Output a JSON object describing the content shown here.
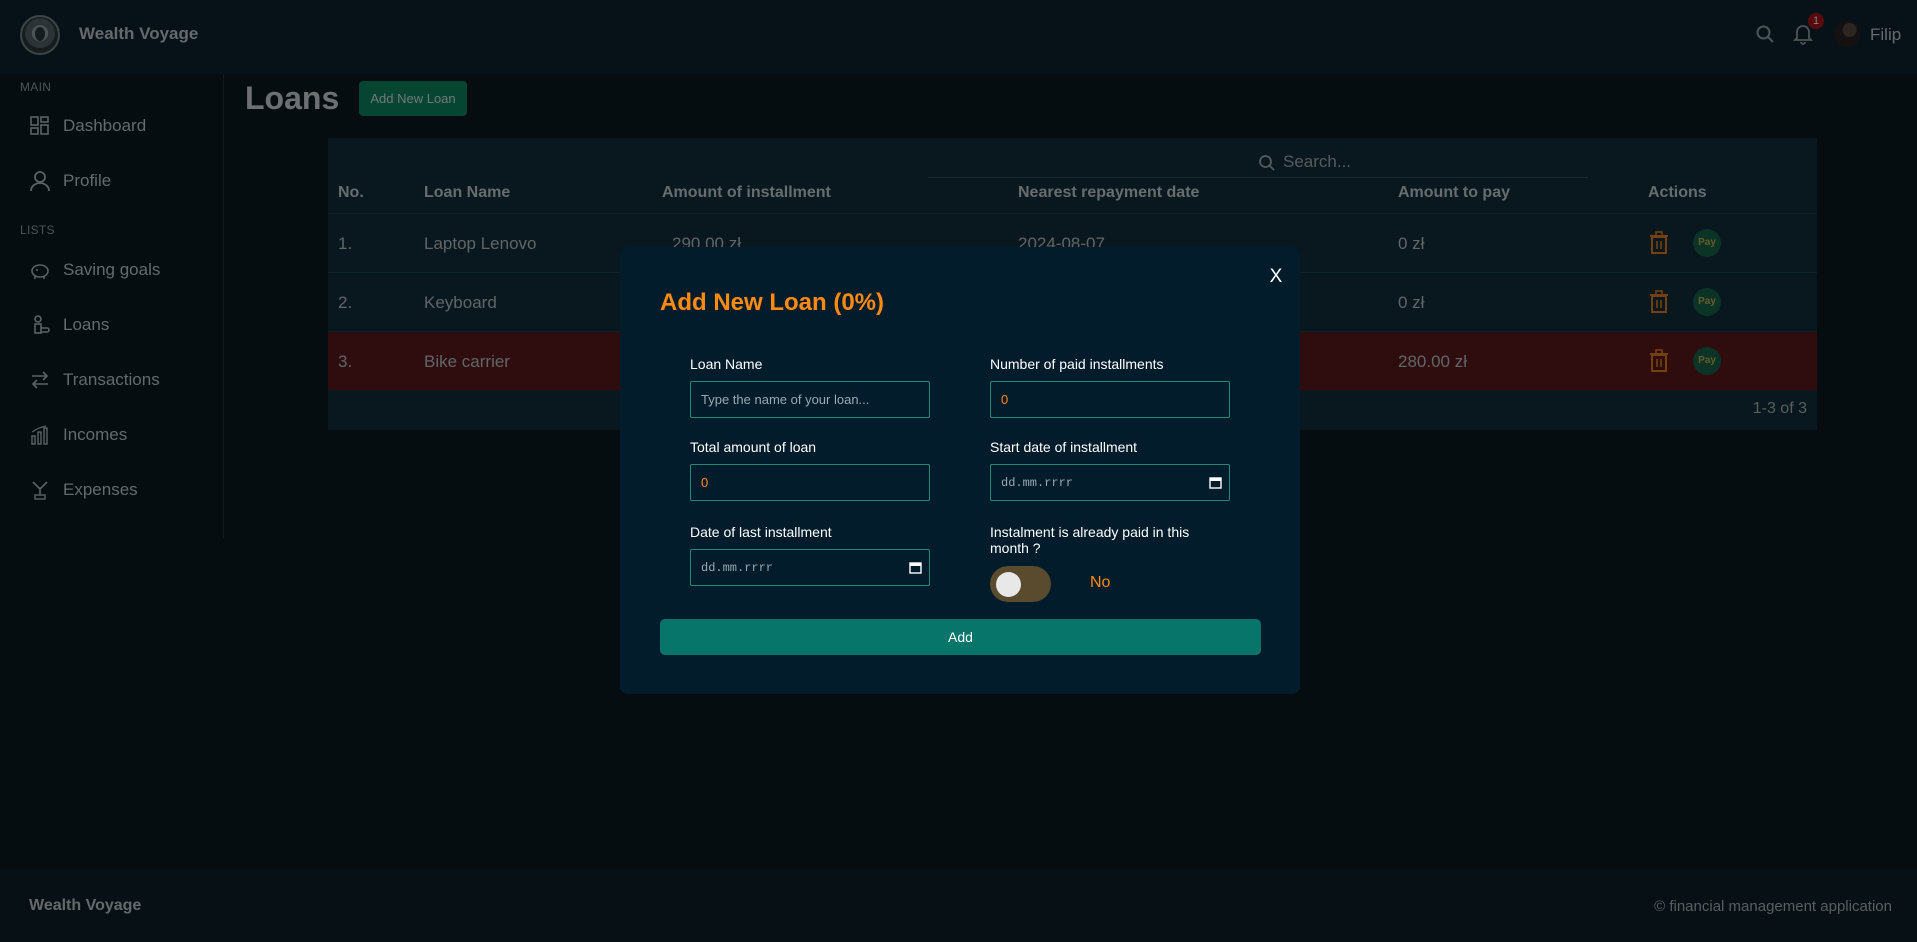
{
  "header": {
    "brand": "Wealth Voyage",
    "notification_count": "1",
    "username": "Filip"
  },
  "sidebar": {
    "sections": [
      {
        "label": "MAIN"
      },
      {
        "label": "LISTS"
      }
    ],
    "items": [
      {
        "label": "Dashboard",
        "icon": "dashboard-icon"
      },
      {
        "label": "Profile",
        "icon": "user-icon"
      },
      {
        "label": "Saving goals",
        "icon": "piggy-bank-icon"
      },
      {
        "label": "Loans",
        "icon": "loan-hand-icon"
      },
      {
        "label": "Transactions",
        "icon": "transfer-arrows-icon"
      },
      {
        "label": "Incomes",
        "icon": "bar-chart-icon"
      },
      {
        "label": "Expenses",
        "icon": "money-fall-icon"
      }
    ]
  },
  "main": {
    "title": "Loans",
    "add_button": "Add New Loan",
    "search_placeholder": "Search...",
    "table": {
      "columns": [
        "No.",
        "Loan Name",
        "Amount of installment",
        "Nearest repayment date",
        "Amount to pay",
        "Actions"
      ],
      "rows": [
        {
          "no": "1.",
          "name": "Laptop Lenovo",
          "installment": "290.00 zł",
          "date": "2024-08-07",
          "to_pay": "0 zł",
          "overdue": false
        },
        {
          "no": "2.",
          "name": "Keyboard",
          "installment": "",
          "date": "",
          "to_pay": "0 zł",
          "overdue": false
        },
        {
          "no": "3.",
          "name": "Bike carrier",
          "installment": "",
          "date": "",
          "to_pay": "280.00 zł",
          "overdue": true
        }
      ],
      "pay_label": "Pay",
      "pagination": "1-3 of 3"
    }
  },
  "modal": {
    "close_label": "X",
    "title": "Add New Loan (0%)",
    "fields": {
      "loan_name": {
        "label": "Loan Name",
        "placeholder": "Type the name of your loan..."
      },
      "paid_installments": {
        "label": "Number of paid installments",
        "value": "0"
      },
      "total_amount": {
        "label": "Total amount of loan",
        "value": "0"
      },
      "start_date": {
        "label": "Start date of installment",
        "placeholder": "dd.mm.rrrr"
      },
      "last_date": {
        "label": "Date of last installment",
        "placeholder": "dd.mm.rrrr"
      },
      "already_paid": {
        "label": "Instalment is already paid in this month ?",
        "value_text": "No"
      }
    },
    "submit": "Add"
  },
  "footer": {
    "brand": "Wealth Voyage",
    "copyright": "© financial management application"
  },
  "colors": {
    "accent_orange": "#ff8a0f",
    "accent_teal": "#08756a",
    "overdue_row": "#5e1a1e"
  }
}
